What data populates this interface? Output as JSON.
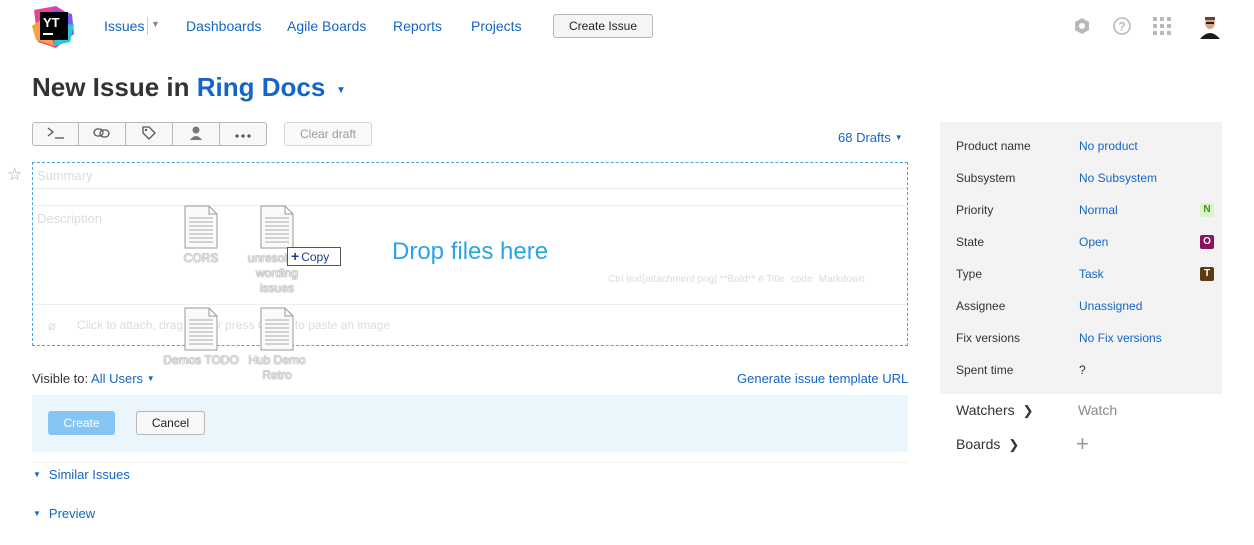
{
  "header": {
    "nav": [
      {
        "label": "Issues"
      },
      {
        "label": "Dashboards"
      },
      {
        "label": "Agile Boards"
      },
      {
        "label": "Reports"
      },
      {
        "label": "Projects"
      }
    ],
    "create_issue_label": "Create Issue",
    "logo_text": "YT",
    "icons": [
      "hexagon-icon",
      "help-icon",
      "apps-grid-icon",
      "user-avatar"
    ]
  },
  "title": {
    "prefix": "New Issue in",
    "project": "Ring Docs"
  },
  "toolbar": {
    "buttons": [
      "command-icon",
      "link-icon",
      "tag-icon",
      "assignee-icon",
      "more-icon"
    ],
    "clear_draft_label": "Clear draft",
    "drafts_label": "68 Drafts"
  },
  "form": {
    "summary_placeholder": "Summary",
    "description_placeholder": "Description",
    "markup_hint": "Ctrl text[attachment.png] **Bold** # Title `code`",
    "markup_hint_link": "Markdown",
    "attach_hint": "Click to attach, drag files or press Ctrl+V to paste an image",
    "drop_label": "Drop files here",
    "copy_label": "Copy",
    "dragged_files": [
      {
        "name": "CORS"
      },
      {
        "name": "unresolved wording issues"
      },
      {
        "name": "Demos TODO"
      },
      {
        "name": "Hub Demo Retro"
      }
    ]
  },
  "visibility": {
    "label": "Visible to:",
    "value": "All Users"
  },
  "generate_template_label": "Generate issue template URL",
  "actions": {
    "create_label": "Create",
    "cancel_label": "Cancel"
  },
  "sections": {
    "similar_issues": "Similar Issues",
    "preview": "Preview"
  },
  "fields": [
    {
      "name": "Product name",
      "value": "No product"
    },
    {
      "name": "Subsystem",
      "value": "No Subsystem"
    },
    {
      "name": "Priority",
      "value": "Normal",
      "badge": "N",
      "badge_bg": "#d9f5c7",
      "badge_color": "#4b8d20"
    },
    {
      "name": "State",
      "value": "Open",
      "badge": "O",
      "badge_bg": "#8a1261",
      "badge_color": "#ffffff"
    },
    {
      "name": "Type",
      "value": "Task",
      "badge": "T",
      "badge_bg": "#5c3a14",
      "badge_color": "#ffffff"
    },
    {
      "name": "Assignee",
      "value": "Unassigned"
    },
    {
      "name": "Fix versions",
      "value": "No Fix versions"
    },
    {
      "name": "Spent time",
      "value": "?"
    }
  ],
  "watchers": {
    "label": "Watchers",
    "action": "Watch"
  },
  "boards": {
    "label": "Boards"
  },
  "colors": {
    "accent": "#1466c6",
    "drop": "#2aa4e6",
    "create_button": "#84c5f4"
  }
}
